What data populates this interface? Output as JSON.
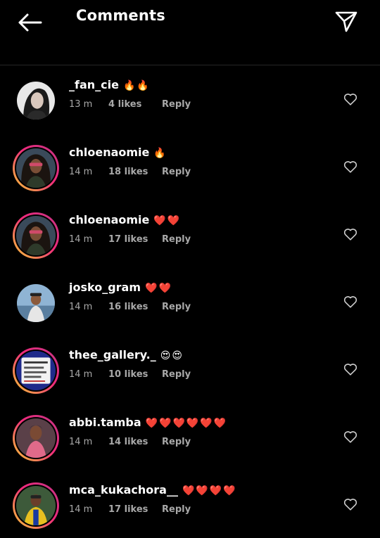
{
  "header": {
    "title": "Comments",
    "back_icon": "arrow-left-icon",
    "share_icon": "send-icon"
  },
  "colors": {
    "background": "#000000",
    "muted_text": "#a8a8a8",
    "story_ring": [
      "#f9ce34",
      "#ee2a7b",
      "#c13584"
    ]
  },
  "comments": [
    {
      "username": "_fan_cie",
      "emojis": "🔥🔥",
      "time": "13 m",
      "likes": "4 likes",
      "reply": "Reply",
      "story_ring": false
    },
    {
      "username": "chloenaomie",
      "emojis": "🔥",
      "time": "14 m",
      "likes": "18 likes",
      "reply": "Reply",
      "story_ring": true
    },
    {
      "username": "chloenaomie",
      "emojis": "❤️❤️",
      "time": "14 m",
      "likes": "17 likes",
      "reply": "Reply",
      "story_ring": true
    },
    {
      "username": "josko_gram",
      "emojis": "❤️❤️",
      "time": "14 m",
      "likes": "16 likes",
      "reply": "Reply",
      "story_ring": false
    },
    {
      "username": "thee_gallery._",
      "emojis": "😍😍",
      "time": "14 m",
      "likes": "10 likes",
      "reply": "Reply",
      "story_ring": true
    },
    {
      "username": "abbi.tamba",
      "emojis": "❤️❤️❤️❤️❤️❤️",
      "time": "14 m",
      "likes": "14 likes",
      "reply": "Reply",
      "story_ring": true
    },
    {
      "username": "mca_kukachora__",
      "emojis": "❤️❤️❤️❤️",
      "time": "14 m",
      "likes": "17 likes",
      "reply": "Reply",
      "story_ring": true
    }
  ]
}
